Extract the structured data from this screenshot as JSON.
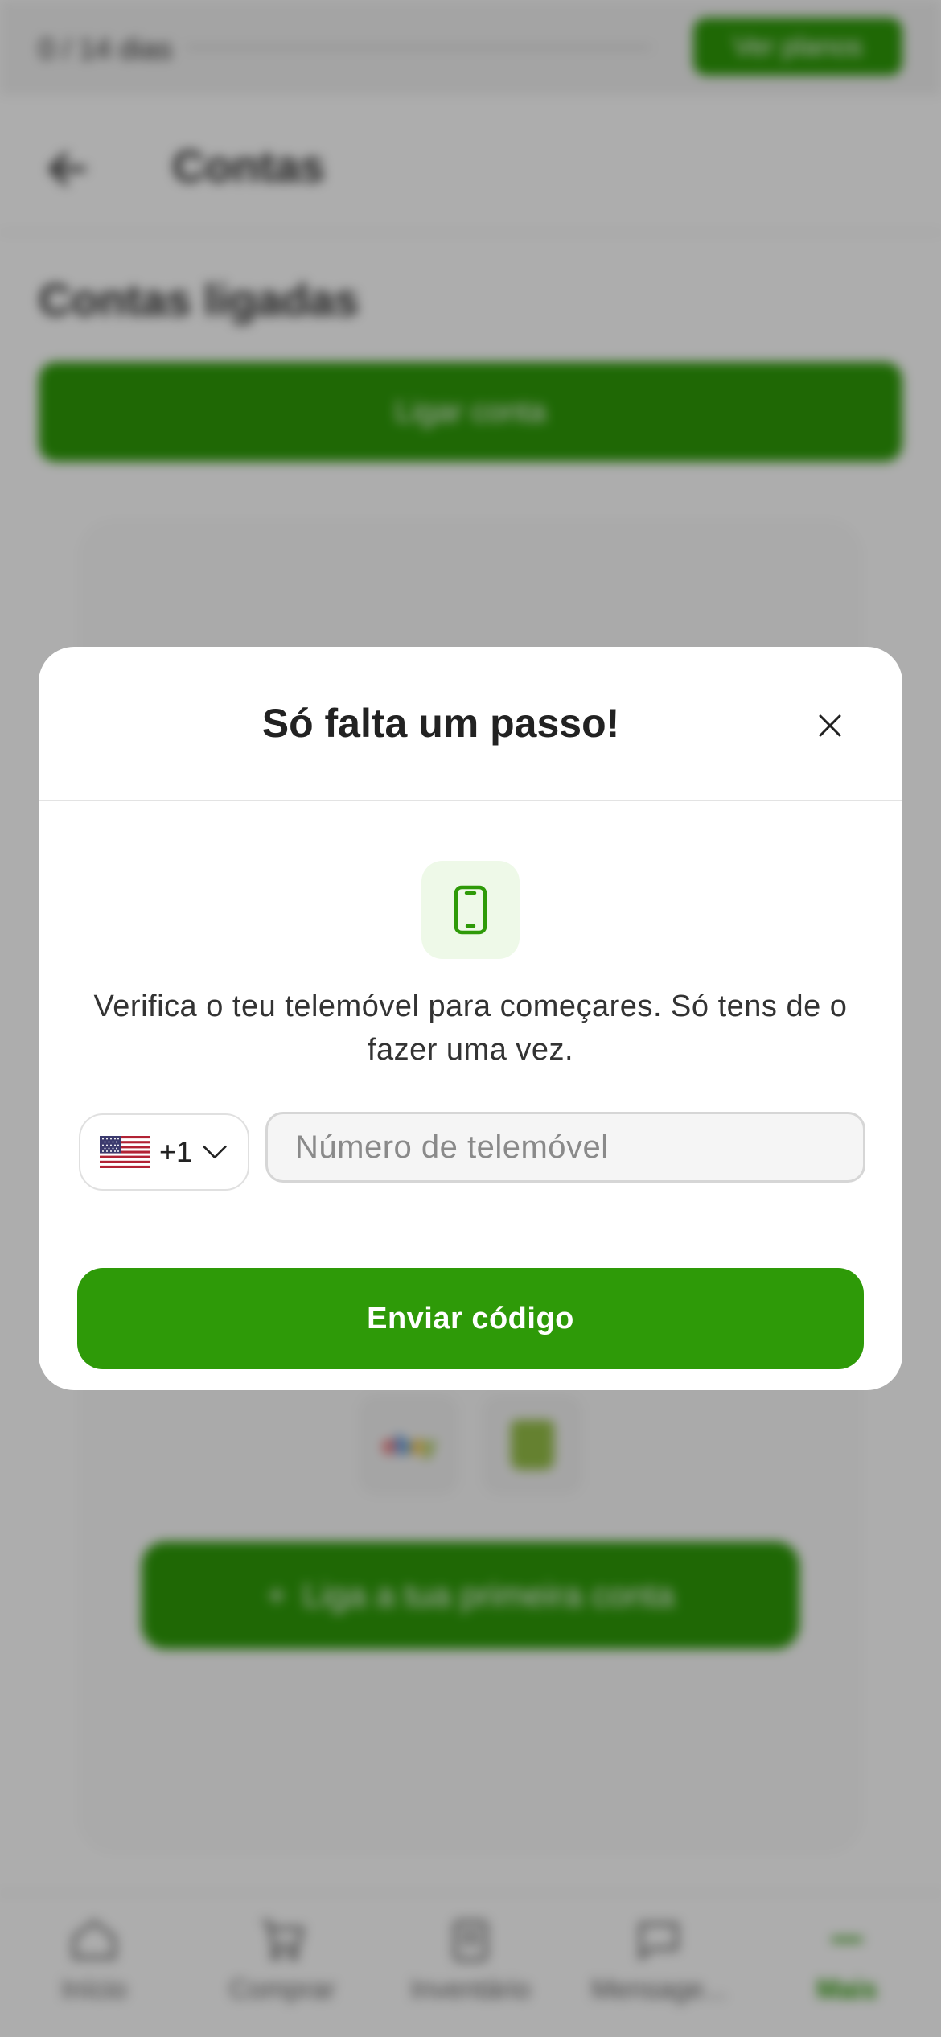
{
  "background": {
    "trial": {
      "text": "0 / 14 dias",
      "plans_button": "Ver planos"
    },
    "header": {
      "title": "Contas"
    },
    "section_title": "Contas ligadas",
    "link_account_button": "Ligar conta",
    "first_account_button": "Liga a tua primeira conta",
    "tabs": [
      {
        "label": "Início",
        "icon": "home-icon"
      },
      {
        "label": "Comprar",
        "icon": "cart-icon"
      },
      {
        "label": "Inventário",
        "icon": "inventory-icon"
      },
      {
        "label": "Mensage...",
        "icon": "message-icon"
      },
      {
        "label": "Mais",
        "icon": "more-icon",
        "active": true
      }
    ]
  },
  "modal": {
    "title": "Só falta um passo!",
    "description": "Verifica o teu telemóvel para começares. Só tens de o fazer uma vez.",
    "country": {
      "flag": "us-flag-icon",
      "dial_code": "+1"
    },
    "phone_placeholder": "Número de telemóvel",
    "phone_value": "",
    "submit_label": "Enviar código"
  },
  "colors": {
    "accent": "#2e9a08",
    "icon_badge_bg": "#eef9e8",
    "overlay": "rgba(0,0,0,0.32)"
  }
}
